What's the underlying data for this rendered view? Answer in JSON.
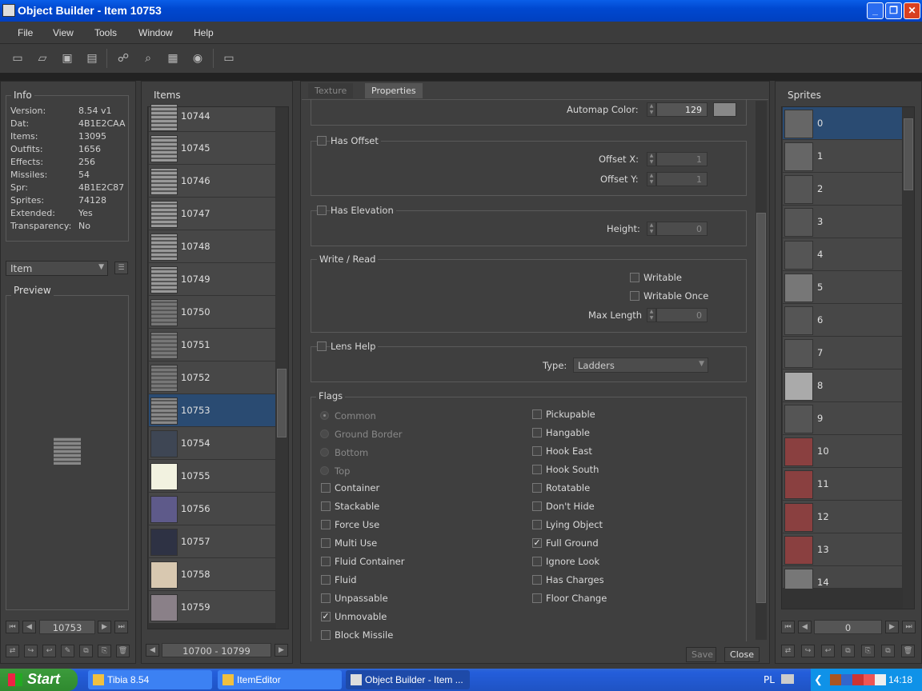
{
  "window": {
    "title": "Object Builder - Item 10753"
  },
  "menu": [
    "File",
    "View",
    "Tools",
    "Window",
    "Help"
  ],
  "info": {
    "title": "Info",
    "rows": [
      {
        "k": "Version:",
        "v": "8.54 v1"
      },
      {
        "k": "Dat:",
        "v": "4B1E2CAA"
      },
      {
        "k": "Items:",
        "v": "13095"
      },
      {
        "k": "Outfits:",
        "v": "1656"
      },
      {
        "k": "Effects:",
        "v": "256"
      },
      {
        "k": "Missiles:",
        "v": "54"
      },
      {
        "k": "Spr:",
        "v": "4B1E2C87"
      },
      {
        "k": "Sprites:",
        "v": "74128"
      },
      {
        "k": "Extended:",
        "v": "Yes"
      },
      {
        "k": "Transparency:",
        "v": "No"
      }
    ]
  },
  "category": "Item",
  "preview_title": "Preview",
  "left_nav_value": "10753",
  "items_title": "Items",
  "items": [
    "10744",
    "10745",
    "10746",
    "10747",
    "10748",
    "10749",
    "10750",
    "10751",
    "10752",
    "10753",
    "10754",
    "10755",
    "10756",
    "10757",
    "10758",
    "10759"
  ],
  "items_range": "10700 - 10799",
  "tabs": [
    "Texture",
    "Properties"
  ],
  "props": {
    "automap_label": "Automap Color:",
    "automap_value": "129",
    "has_offset": "Has Offset",
    "offset_x_label": "Offset X:",
    "offset_x": "1",
    "offset_y_label": "Offset Y:",
    "offset_y": "1",
    "has_elevation": "Has Elevation",
    "height_label": "Height:",
    "height": "0",
    "write_read": "Write / Read",
    "writable": "Writable",
    "writable_once": "Writable Once",
    "max_length_label": "Max Length",
    "max_length": "0",
    "lens_help": "Lens Help",
    "type_label": "Type:",
    "type_value": "Ladders",
    "flags_title": "Flags",
    "radios": [
      "Common",
      "Ground Border",
      "Bottom",
      "Top"
    ],
    "left_flags": [
      "Container",
      "Stackable",
      "Force Use",
      "Multi Use",
      "Fluid Container",
      "Fluid",
      "Unpassable",
      "Unmovable",
      "Block Missile"
    ],
    "right_flags": [
      "Pickupable",
      "Hangable",
      "Hook East",
      "Hook South",
      "Rotatable",
      "Don't Hide",
      "Lying Object",
      "Full Ground",
      "Ignore Look",
      "Has Charges",
      "Floor Change"
    ]
  },
  "buttons": {
    "save": "Save",
    "close": "Close"
  },
  "sprites_title": "Sprites",
  "sprites": [
    "0",
    "1",
    "2",
    "3",
    "4",
    "5",
    "6",
    "7",
    "8",
    "9",
    "10",
    "11",
    "12",
    "13",
    "14"
  ],
  "sprite_nav_value": "0",
  "taskbar": {
    "start": "Start",
    "tasks": [
      "Tibia 8.54",
      "ItemEditor",
      "Object Builder - Item ..."
    ],
    "lang": "PL",
    "clock": "14:18"
  }
}
